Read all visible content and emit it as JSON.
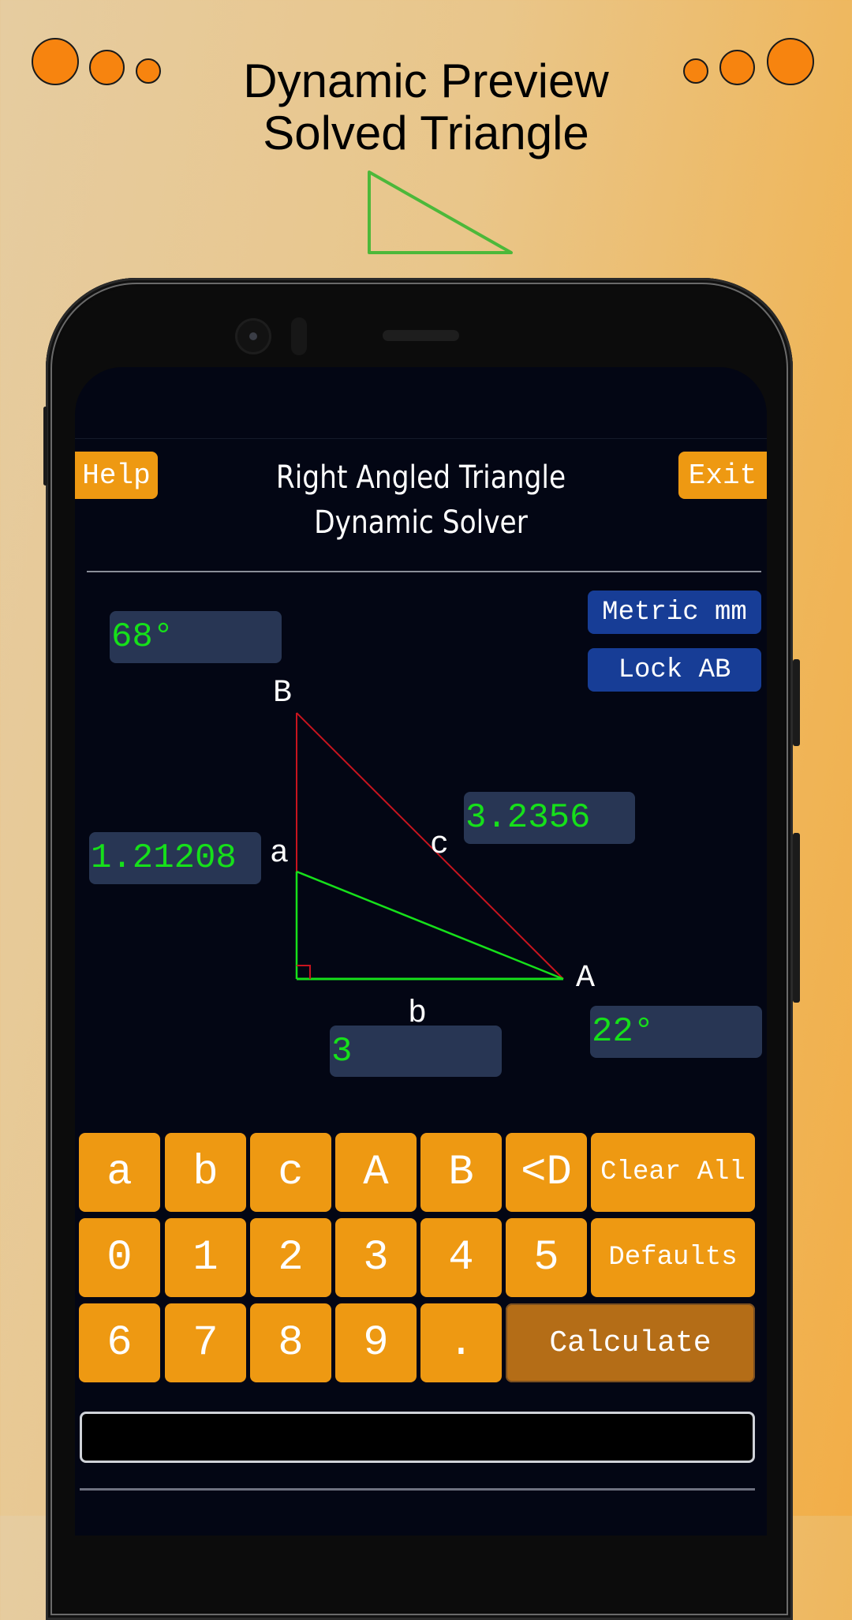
{
  "promo": {
    "title_line1": "Dynamic Preview",
    "title_line2": "Solved Triangle",
    "accent_color": "#f7840f",
    "preview_triangle_color": "#4cb83a"
  },
  "app": {
    "help_label": "Help",
    "exit_label": "Exit",
    "title_line1": "Right Angled Triangle",
    "title_line2": "Dynamic  Solver",
    "units_button": "Metric mm",
    "lock_button": "Lock AB"
  },
  "triangle": {
    "vertex_labels": {
      "B": "B",
      "A": "A"
    },
    "side_labels": {
      "a": "a",
      "b": "b",
      "c": "c"
    },
    "values": {
      "angle_B": "68°",
      "side_a": "1.21208",
      "side_c": "3.2356",
      "side_b": "3",
      "angle_A": "22°"
    },
    "colors": {
      "solved": "#16e01a",
      "preview": "#c8141e",
      "field_bg": "#283654"
    }
  },
  "keypad": {
    "rows": [
      [
        "a",
        "b",
        "c",
        "A",
        "B",
        "<D",
        "Clear All"
      ],
      [
        "0",
        "1",
        "2",
        "3",
        "4",
        "5",
        "Defaults"
      ],
      [
        "6",
        "7",
        "8",
        "9",
        ".",
        "Calculate"
      ]
    ],
    "key_color": "#ee9912",
    "calculate_color": "#b46d17"
  },
  "output": {
    "text": ""
  }
}
